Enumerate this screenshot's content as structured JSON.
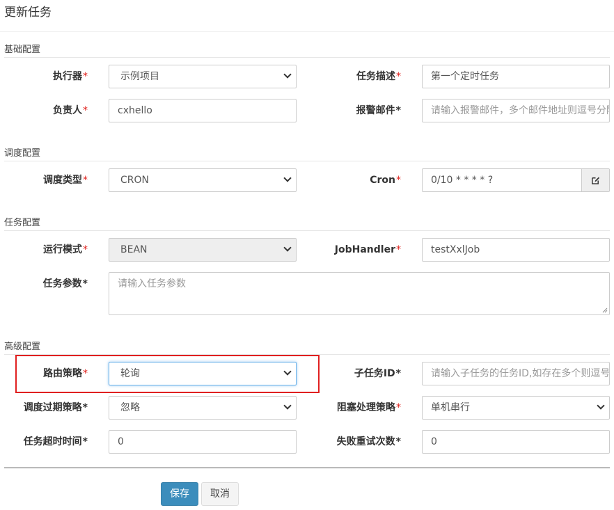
{
  "dialog": {
    "title": "更新任务"
  },
  "sections": {
    "basic": "基础配置",
    "schedule": "调度配置",
    "task": "任务配置",
    "advanced": "高级配置"
  },
  "fields": {
    "executor": {
      "label": "执行器",
      "value": "示例项目"
    },
    "job_desc": {
      "label": "任务描述",
      "value": "第一个定时任务"
    },
    "author": {
      "label": "负责人",
      "value": "cxhello"
    },
    "alarm_email": {
      "label": "报警邮件",
      "placeholder": "请输入报警邮件，多个邮件地址则逗号分隔"
    },
    "schedule_type": {
      "label": "调度类型",
      "value": "CRON"
    },
    "cron": {
      "label": "Cron",
      "value": "0/10 * * * * ?"
    },
    "run_mode": {
      "label": "运行模式",
      "value": "BEAN"
    },
    "job_handler": {
      "label": "JobHandler",
      "value": "testXxlJob"
    },
    "job_param": {
      "label": "任务参数",
      "placeholder": "请输入任务参数"
    },
    "route_strategy": {
      "label": "路由策略",
      "value": "轮询"
    },
    "child_job_id": {
      "label": "子任务ID",
      "placeholder": "请输入子任务的任务ID,如存在多个则逗号分隔"
    },
    "misfire_strategy": {
      "label": "调度过期策略",
      "value": "忽略"
    },
    "block_strategy": {
      "label": "阻塞处理策略",
      "value": "单机串行"
    },
    "timeout": {
      "label": "任务超时时间",
      "value": "0"
    },
    "fail_retry": {
      "label": "失败重试次数",
      "value": "0"
    }
  },
  "required_mark": "*",
  "buttons": {
    "save": "保存",
    "cancel": "取消"
  },
  "colors": {
    "primary": "#3c8dbc",
    "required": "#e0211d",
    "highlight": "#e02020"
  },
  "icons": {
    "cron_edit": "edit-icon",
    "select_caret": "chevron-down-icon"
  }
}
